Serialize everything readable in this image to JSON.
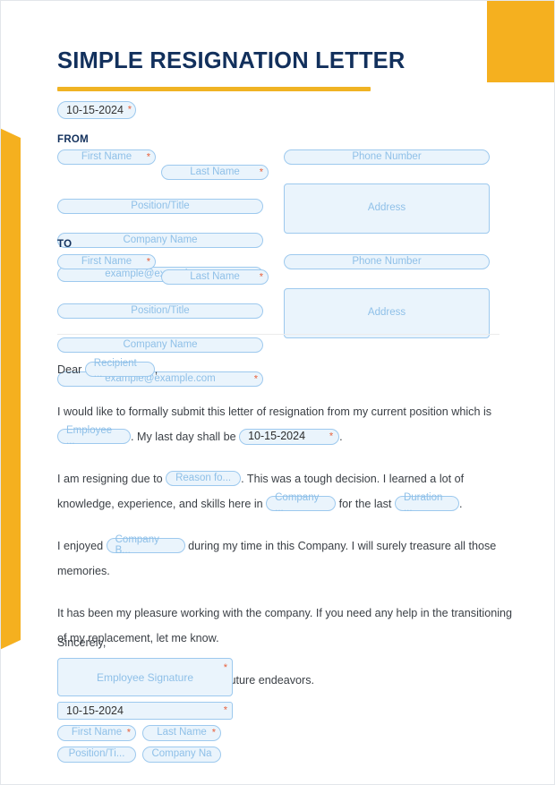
{
  "document": {
    "title": "SIMPLE RESIGNATION LETTER",
    "top_date_value": "10-15-2024",
    "required_marker": "*"
  },
  "colors": {
    "accent_yellow": "#f5b01f",
    "title_navy": "#12305c",
    "field_fill": "#eaf4fc",
    "field_border": "#9dc9ee",
    "placeholder_text": "#8fc0e8",
    "required_red": "#e8603c",
    "body_text": "#3a3f45"
  },
  "from_section": {
    "label": "FROM",
    "first_name": "First Name",
    "last_name": "Last Name",
    "position_title": "Position/Title",
    "company_name": "Company Name",
    "email": "example@example.com",
    "phone_number": "Phone Number",
    "address": "Address"
  },
  "to_section": {
    "label": "TO",
    "first_name": "First Name",
    "last_name": "Last Name",
    "position_title": "Position/Title",
    "company_name": "Company Name",
    "email": "example@example.com",
    "phone_number": "Phone Number",
    "address": "Address"
  },
  "letter": {
    "salutation_prefix": "Dear",
    "recipient_placeholder": "Recipient ...",
    "salutation_suffix": ",",
    "p1_part1": "I would like to formally submit this letter of resignation from my current position which is",
    "p1_employee_placeholder": "Employee ...",
    "p1_part2": ". My last day shall be",
    "p1_date_value": "10-15-2024",
    "p1_part3": ".",
    "p2_part1": "I am resigning due to",
    "p2_reason_placeholder": "Reason fo...",
    "p2_part2": ". This was a tough decision. I learned a lot of knowledge, experience, and skills here in",
    "p2_company_placeholder": "Company ...",
    "p2_part3": "for the last",
    "p2_duration_placeholder": "Duration ...",
    "p2_part4": ".",
    "p3_part1": "I enjoyed",
    "p3_benefit_placeholder": "Company B...",
    "p3_part2": "during my time in this Company. I will surely treasure all those memories.",
    "p4": "It has been my pleasure working with the company. If you need any help in the transitioning of my replacement, let me know.",
    "p5": "I wish the company all the best in future endeavors.",
    "closing": "Sincerely,"
  },
  "signature": {
    "signature_placeholder": "Employee Signature",
    "date_value": "10-15-2024",
    "first_name": "First Name",
    "last_name": "Last Name",
    "position_title": "Position/Ti...",
    "company_name": "Company Na"
  }
}
